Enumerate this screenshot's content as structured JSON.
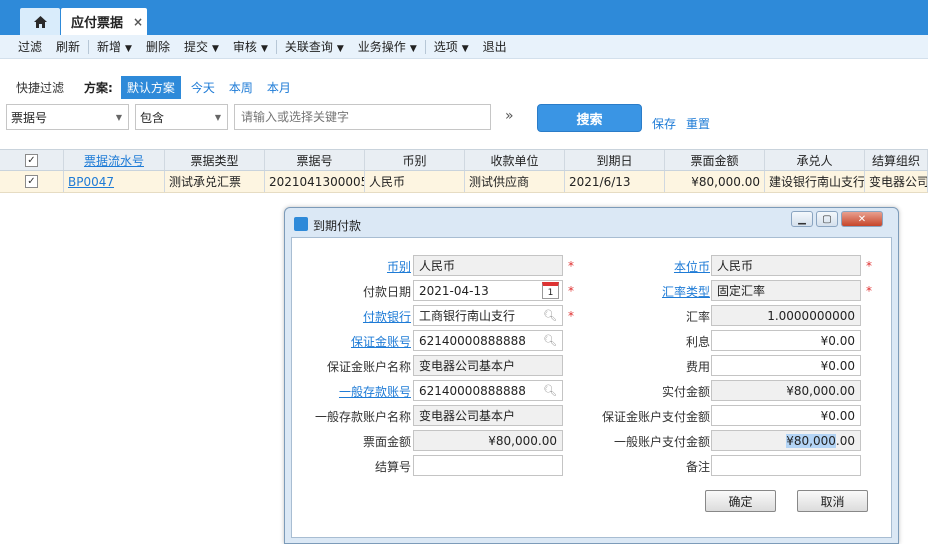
{
  "tabs": {
    "active_label": "应付票据",
    "close_glyph": "×"
  },
  "menu": [
    {
      "label": "过滤",
      "caret": false
    },
    {
      "label": "刷新",
      "caret": false
    },
    {
      "label": "新增",
      "caret": true
    },
    {
      "label": "删除",
      "caret": false
    },
    {
      "label": "提交",
      "caret": true
    },
    {
      "label": "审核",
      "caret": true
    },
    {
      "label": "关联查询",
      "caret": true
    },
    {
      "label": "业务操作",
      "caret": true
    },
    {
      "label": "选项",
      "caret": true
    },
    {
      "label": "退出",
      "caret": false
    }
  ],
  "quick": {
    "label": "快捷过滤",
    "scheme_label": "方案:",
    "schemes": [
      "默认方案",
      "今天",
      "本周",
      "本月"
    ],
    "active_scheme": "默认方案"
  },
  "filter": {
    "field": "票据号",
    "operator": "包含",
    "keyword_placeholder": "请输入或选择关键字",
    "search_label": "搜索",
    "save_label": "保存",
    "reset_label": "重置"
  },
  "grid": {
    "headers": [
      "票据流水号",
      "票据类型",
      "票据号",
      "币别",
      "收款单位",
      "到期日",
      "票面金额",
      "承兑人",
      "结算组织"
    ],
    "rows": [
      [
        "BP0047",
        "测试承兑汇票",
        "2021041300005",
        "人民币",
        "测试供应商",
        "2021/6/13",
        "¥80,000.00",
        "建设银行南山支行",
        "变电器公司"
      ]
    ]
  },
  "dialog": {
    "title": "到期付款",
    "left": [
      {
        "label": "币别",
        "value": "人民币",
        "link": true,
        "ro": true,
        "required": true
      },
      {
        "label": "付款日期",
        "value": "2021-04-13",
        "link": false,
        "ro": false,
        "required": true,
        "calendar": true
      },
      {
        "label": "付款银行",
        "value": "工商银行南山支行",
        "link": true,
        "ro": false,
        "required": true,
        "lookup": true
      },
      {
        "label": "保证金账号",
        "value": "62140000888888",
        "link": true,
        "ro": false,
        "lookup": true
      },
      {
        "label": "保证金账户名称",
        "value": "变电器公司基本户",
        "link": false,
        "ro": true
      },
      {
        "label": "一般存款账号",
        "value": "62140000888888",
        "link": true,
        "ro": false,
        "lookup": true
      },
      {
        "label": "一般存款账户名称",
        "value": "变电器公司基本户",
        "link": false,
        "ro": true
      },
      {
        "label": "票面金额",
        "value": "¥80,000.00",
        "link": false,
        "ro": true,
        "num": true
      },
      {
        "label": "结算号",
        "value": "",
        "link": false,
        "ro": false
      }
    ],
    "right": [
      {
        "label": "本位币",
        "value": "人民币",
        "link": true,
        "ro": true,
        "required": true
      },
      {
        "label": "汇率类型",
        "value": "固定汇率",
        "link": true,
        "ro": true,
        "required": true
      },
      {
        "label": "汇率",
        "value": "1.0000000000",
        "link": false,
        "ro": true,
        "num": true
      },
      {
        "label": "利息",
        "value": "¥0.00",
        "link": false,
        "ro": false,
        "num": true
      },
      {
        "label": "费用",
        "value": "¥0.00",
        "link": false,
        "ro": false,
        "num": true
      },
      {
        "label": "实付金额",
        "value": "¥80,000.00",
        "link": false,
        "ro": true,
        "num": true
      },
      {
        "label": "保证金账户支付金额",
        "value": "¥0.00",
        "link": false,
        "ro": false,
        "num": true
      },
      {
        "label": "一般账户支付金额",
        "value": "¥80,000.00",
        "link": false,
        "ro": true,
        "num": true,
        "highlight": "¥80,000",
        "rest": ".00"
      },
      {
        "label": "备注",
        "value": "",
        "link": false,
        "ro": false
      }
    ],
    "ok_label": "确定",
    "cancel_label": "取消",
    "calendar_day": "1",
    "required_mark": "*"
  },
  "colors": {
    "accent": "#2e8ad9",
    "link": "#1e7bd6",
    "row_highlight": "#fdf5e1",
    "required": "#e03030"
  }
}
